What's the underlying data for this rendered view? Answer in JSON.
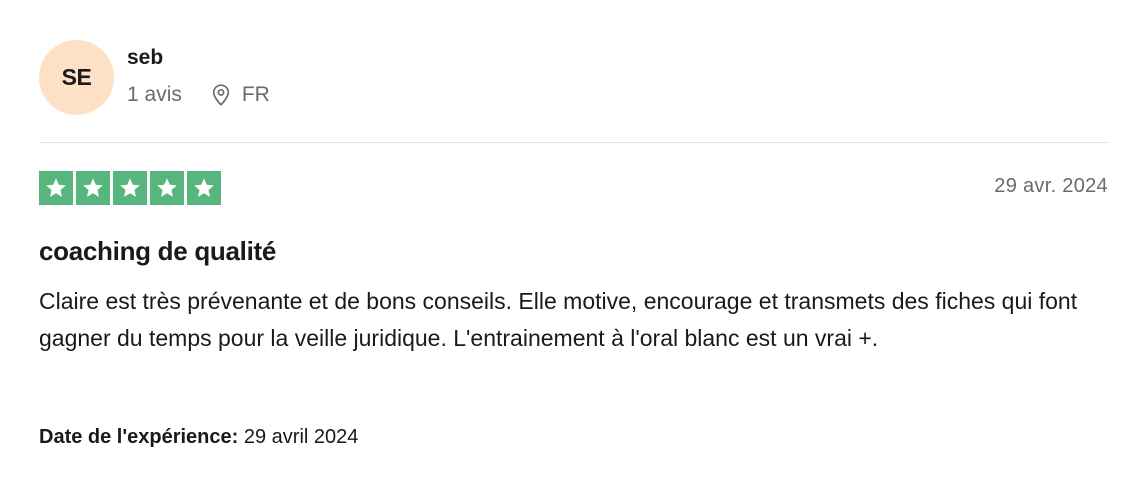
{
  "reviewer": {
    "initials": "SE",
    "avatar_color": "#fde0c5",
    "name": "seb",
    "review_count": "1 avis",
    "location_icon": "location-pin-icon",
    "country": "FR"
  },
  "review": {
    "rating": 5,
    "rating_max": 5,
    "star_color": "#56b67d",
    "date": "29 avr. 2024",
    "title": "coaching de qualité",
    "body": "Claire est très prévenante et de bons conseils. Elle motive, encourage et transmets des fiches qui font gagner du temps pour la veille juridique. L'entrainement à l'oral blanc est un vrai +.",
    "experience_label": "Date de l'expérience:",
    "experience_date": "29 avril 2024"
  }
}
